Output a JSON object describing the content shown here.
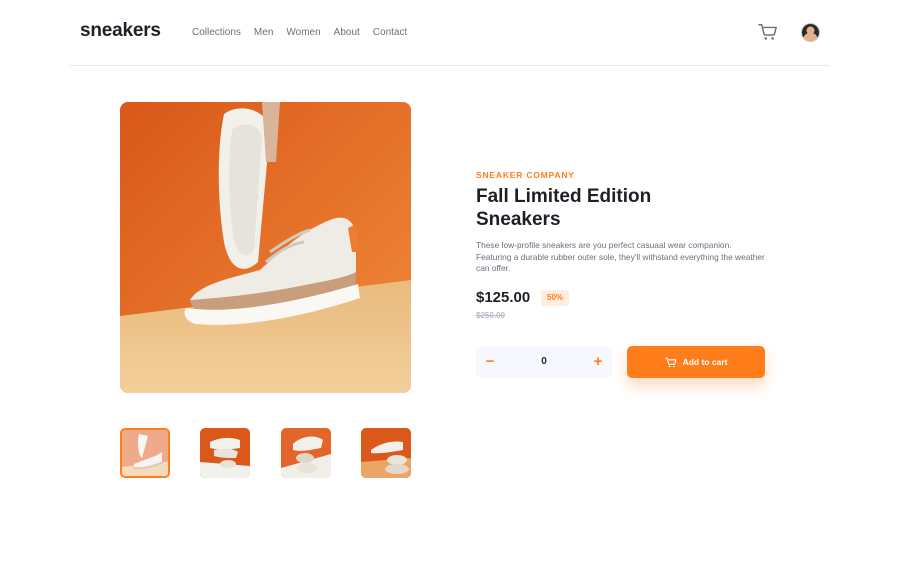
{
  "header": {
    "logo": "sneakers",
    "nav": [
      "Collections",
      "Men",
      "Women",
      "About",
      "Contact"
    ],
    "cart_icon": "cart-icon",
    "avatar": "user-avatar"
  },
  "product": {
    "company": "SNEAKER COMPANY",
    "title": "Fall Limited Edition Sneakers",
    "description": "These low-profile sneakers are you perfect casuaal wear companion. Featuring a durable rubber outer sole, they'll withstand everything the weather can offer.",
    "price": "$125.00",
    "discount": "50%",
    "old_price": "$250.00",
    "quantity": "0",
    "minus_label": "−",
    "plus_label": "+",
    "add_to_cart": "Add to cart"
  },
  "gallery": {
    "thumbnails": [
      "product-1",
      "product-2",
      "product-3",
      "product-4"
    ],
    "active_index": 0
  },
  "colors": {
    "accent": "#ff7e1b",
    "accent_pale": "#ffede0",
    "text_dark": "#1d2026",
    "text_gray": "#69707d"
  }
}
